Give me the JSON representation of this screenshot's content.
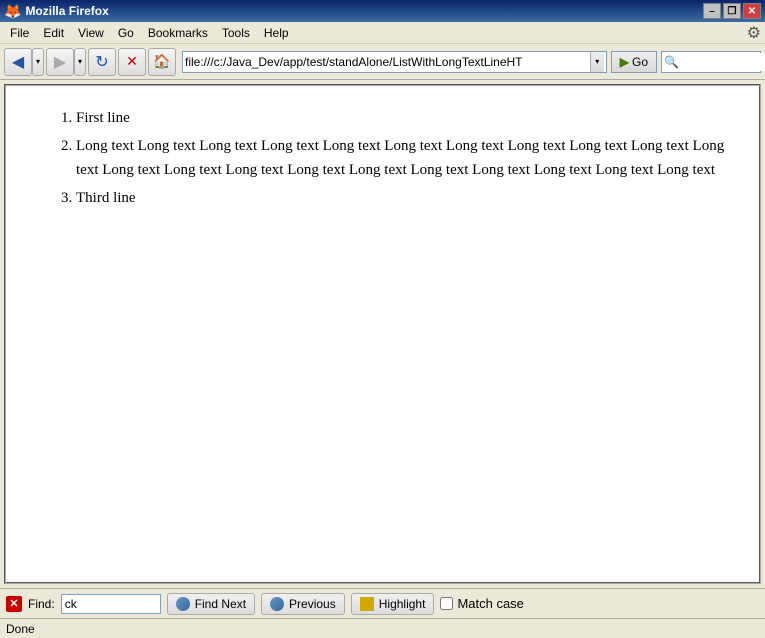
{
  "titlebar": {
    "title": "Mozilla Firefox",
    "icon": "🦊",
    "buttons": {
      "minimize": "–",
      "restore": "❐",
      "close": "✕"
    }
  },
  "menubar": {
    "items": [
      "File",
      "Edit",
      "View",
      "Go",
      "Bookmarks",
      "Tools",
      "Help"
    ]
  },
  "toolbar": {
    "back_label": "◀",
    "forward_label": "▶",
    "refresh_label": "↻",
    "stop_label": "✕",
    "home_label": "🏠",
    "address_label": "",
    "address_value": "file:///c:/Java_Dev/app/test/standAlone/ListWithLongTextLineHT",
    "go_label": "Go",
    "go_icon": "▶",
    "search_placeholder": "🔍"
  },
  "content": {
    "list_items": [
      {
        "index": 1,
        "text": "First line"
      },
      {
        "index": 2,
        "text": "Long text Long text Long text Long text Long text Long text Long text Long text Long text Long text Long text Long text Long text Long text Long text Long text Long text Long text Long text Long text Long text"
      },
      {
        "index": 3,
        "text": "Third line"
      }
    ]
  },
  "findbar": {
    "close_label": "✕",
    "find_label": "Find:",
    "find_value": "ck",
    "find_placeholder": "",
    "find_next_label": "Find Next",
    "find_previous_label": "Previous",
    "highlight_label": "Highlight",
    "match_case_label": "Match case",
    "match_case_checked": false
  },
  "statusbar": {
    "status_text": "Done"
  },
  "settings_icon": "⚙"
}
